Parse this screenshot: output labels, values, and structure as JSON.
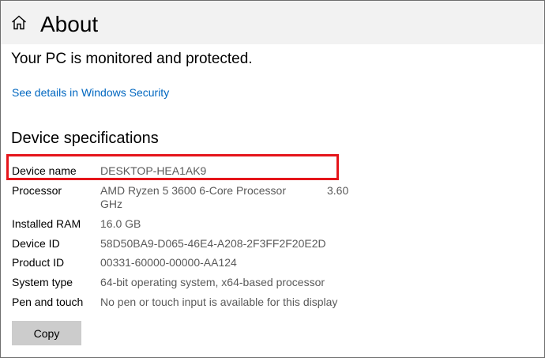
{
  "header": {
    "title": "About",
    "home_icon": "home-icon"
  },
  "security": {
    "status_text": "Your PC is monitored and protected.",
    "link_text": "See details in Windows Security"
  },
  "device_specs": {
    "heading": "Device specifications",
    "highlight_color": "#e5151b",
    "rows": [
      {
        "label": "Device name",
        "value": "DESKTOP-HEA1AK9"
      },
      {
        "label": "Processor",
        "value": "AMD Ryzen 5 3600 6-Core Processor",
        "value_extra": "3.60",
        "value_cont": "GHz"
      },
      {
        "label": "Installed RAM",
        "value": "16.0 GB"
      },
      {
        "label": "Device ID",
        "value": "58D50BA9-D065-46E4-A208-2F3FF2F20E2D"
      },
      {
        "label": "Product ID",
        "value": "00331-60000-00000-AA124"
      },
      {
        "label": "System type",
        "value": "64-bit operating system, x64-based processor"
      },
      {
        "label": "Pen and touch",
        "value": "No pen or touch input is available for this display"
      }
    ],
    "copy_label": "Copy"
  },
  "colors": {
    "link": "#0067c0",
    "value_text": "#5a5a5a",
    "title_bar": "#f2f2f2",
    "button": "#cccccc"
  }
}
